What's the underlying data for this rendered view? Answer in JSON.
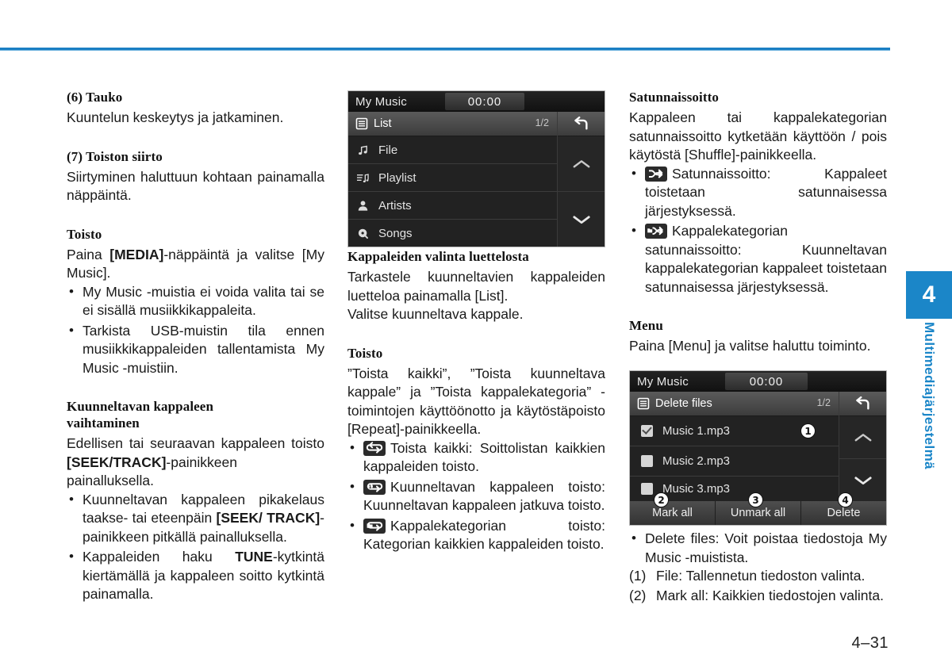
{
  "page": {
    "number": "4–31",
    "chapter_number": "4",
    "chapter_label": "Multimediajärjestelmä",
    "accent_color": "#1b86c8",
    "rule_color": "#1b7fc4"
  },
  "column1": {
    "s1_heading": "(6) Tauko",
    "s1_body": "Kuuntelun keskeytys ja jatkaminen.",
    "s2_heading": "(7) Toiston siirto",
    "s2_body": "Siirtyminen haluttuun kohtaan painamalla näppäintä.",
    "s3_heading": "Toisto",
    "s3_body_pre": "Paina ",
    "s3_body_bold": "[MEDIA]",
    "s3_body_post": "-näppäintä ja valitse [My Music].",
    "s3_bullets": [
      "My Music -muistia ei voida valita tai se ei sisällä musiikkikappaleita.",
      "Tarkista USB-muistin tila ennen musiikkikappaleiden tallentamista My Music -muistiin."
    ],
    "s4_heading_line1": "Kuunneltavan kappaleen",
    "s4_heading_line2": "vaihtaminen",
    "s4_body_pre": "Edellisen tai seuraavan kappaleen toisto  ",
    "s4_body_bold": "[SEEK/TRACK]",
    "s4_body_post": "-painikkeen painalluksella.",
    "s4_bullet1_pre": "Kuunneltavan kappaleen pikakelaus taakse- tai eteenpäin ",
    "s4_bullet1_bold": "[SEEK/ TRACK]",
    "s4_bullet1_post": "-painikkeen pitkällä painalluksella.",
    "s4_bullet2_pre": "Kappaleiden haku ",
    "s4_bullet2_bold": "TUNE",
    "s4_bullet2_post": "-kytkintä kiertämällä ja kappaleen soitto kytkintä painamalla."
  },
  "screen_list": {
    "title": "My Music",
    "time": "00:00",
    "bar_label": "List",
    "page_indicator": "1/2",
    "back_icon": "back-arrow-icon",
    "list_icon": "list-icon",
    "up_icon": "chevron-up-icon",
    "down_icon": "chevron-down-icon",
    "rows": [
      {
        "label": "File",
        "icon": "music-note-icon"
      },
      {
        "label": "Playlist",
        "icon": "playlist-icon"
      },
      {
        "label": "Artists",
        "icon": "person-icon"
      },
      {
        "label": "Songs",
        "icon": "disc-icon"
      }
    ]
  },
  "column2": {
    "s1_heading": "Kappaleiden valinta luettelosta",
    "s1_body1": "Tarkastele kuunneltavien kappaleiden luetteloa painamalla [List].",
    "s1_body2": "Valitse kuunneltava kappale.",
    "s2_heading": "Toisto",
    "s2_body": "”Toista kaikki”, ”Toista kuunneltava kappale” ja ”Toista kappalekategoria” -toimintojen käyttöönotto ja käytöstäpoisto [Repeat]-painikkeella.",
    "bullets": [
      {
        "icon": "repeat-all-icon",
        "text": "Toista kaikki: Soittolistan kaikkien kappaleiden toisto."
      },
      {
        "icon": "repeat-one-icon",
        "text": "Kuunneltavan kappaleen toisto: Kuunneltavan kappaleen jatkuva toisto."
      },
      {
        "icon": "repeat-folder-icon",
        "text": "Kappalekategorian toisto: Kategorian kaikkien kappaleiden toisto."
      }
    ]
  },
  "column3": {
    "s1_heading": "Satunnaissoitto",
    "s1_body": "Kappaleen tai kappalekategorian satunnaissoitto kytketään käyttöön / pois käytöstä [Shuffle]-painikkeella.",
    "bullets": [
      {
        "icon": "shuffle-icon",
        "text": "Satunnaissoitto: Kappaleet toistetaan satunnaisessa järjestyksessä."
      },
      {
        "icon": "shuffle-folder-icon",
        "text": "Kappalekategorian satunnaissoitto: Kuunneltavan kappalekategorian kappaleet toistetaan satunnaisessa järjestyksessä."
      }
    ],
    "s2_heading": "Menu",
    "s2_body": "Paina [Menu] ja valitse haluttu toiminto.",
    "after_bullet": "Delete files: Voit poistaa tiedostoja My Music -muistista.",
    "numbered": [
      {
        "num": "(1)",
        "text": "File: Tallennetun tiedoston valinta."
      },
      {
        "num": "(2)",
        "text": "Mark all: Kaikkien tiedostojen valinta."
      }
    ]
  },
  "screen_delete": {
    "title": "My Music",
    "time": "00:00",
    "bar_label": "Delete files",
    "page_indicator": "1/2",
    "back_icon": "back-arrow-icon",
    "list_icon": "list-icon",
    "up_icon": "chevron-up-icon",
    "down_icon": "chevron-down-icon",
    "rows": [
      {
        "label": "Music 1.mp3",
        "checked": true,
        "marker": "❶"
      },
      {
        "label": "Music 2.mp3",
        "checked": false,
        "marker": ""
      },
      {
        "label": "Music 3.mp3",
        "checked": false,
        "marker": ""
      }
    ],
    "footer": [
      {
        "label": "Mark all",
        "marker": "❷"
      },
      {
        "label": "Unmark all",
        "marker": "❸"
      },
      {
        "label": "Delete",
        "marker": "❹"
      }
    ]
  }
}
